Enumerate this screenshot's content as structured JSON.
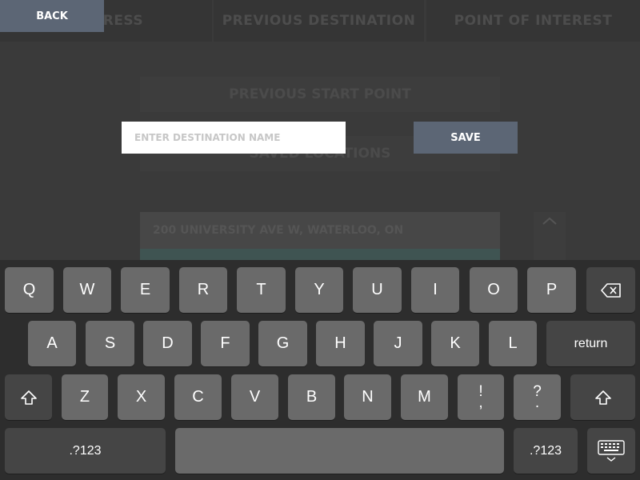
{
  "header": {
    "back_label": "BACK",
    "tabs": [
      {
        "label": "ADDRESS"
      },
      {
        "label": "PREVIOUS DESTINATION"
      },
      {
        "label": "POINT OF INTEREST"
      }
    ]
  },
  "background": {
    "previous_start_point": "PREVIOUS START POINT",
    "saved_locations": "SAVED LOCATIONS",
    "address_item": "200 UNIVERSITY AVE W, WATERLOO, ON"
  },
  "form": {
    "destination_placeholder": "ENTER DESTINATION NAME",
    "destination_value": "",
    "save_label": "SAVE"
  },
  "keyboard": {
    "row1": [
      "Q",
      "W",
      "E",
      "R",
      "T",
      "Y",
      "U",
      "I",
      "O",
      "P"
    ],
    "row2": [
      "A",
      "S",
      "D",
      "F",
      "G",
      "H",
      "J",
      "K",
      "L"
    ],
    "row3": [
      "Z",
      "X",
      "C",
      "V",
      "B",
      "N",
      "M"
    ],
    "return_label": "return",
    "numbers_label": ".?123",
    "excl_top": "!",
    "excl_bottom": ",",
    "quest_top": "?",
    "quest_bottom": ".",
    "icons": {
      "backspace": "backspace-icon",
      "shift": "shift-icon",
      "hide": "keyboard-hide-icon"
    }
  },
  "colors": {
    "button": "#5c6675",
    "key": "#6a6a6a",
    "key_dark": "#454545",
    "overlay": "#3a3a3a"
  }
}
